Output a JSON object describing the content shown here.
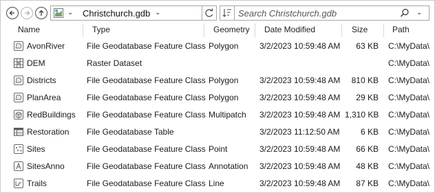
{
  "toolbar": {
    "back_icon": "arrow-left-icon",
    "forward_icon": "arrow-right-icon",
    "up_icon": "arrow-up-icon",
    "address_value": "Christchurch.gdb",
    "address_icon": "geodatabase-icon",
    "refresh_icon": "refresh-icon",
    "sort_icon": "sort-icon",
    "search_placeholder": "Search Christchurch.gdb",
    "search_icon": "search-icon"
  },
  "columns": [
    "Name",
    "Type",
    "Geometry",
    "Date Modified",
    "Size",
    "Path"
  ],
  "rows": [
    {
      "icon": "polygon-feature-class-icon",
      "name": "AvonRiver",
      "type": "File Geodatabase Feature Class",
      "geometry": "Polygon",
      "date": "3/2/2023 10:59:48 AM",
      "size": "63 KB",
      "path": "C:\\MyData\\"
    },
    {
      "icon": "raster-dataset-icon",
      "name": "DEM",
      "type": "Raster Dataset",
      "geometry": "",
      "date": "",
      "size": "",
      "path": "C:\\MyData\\"
    },
    {
      "icon": "polygon-feature-class-icon",
      "name": "Districts",
      "type": "File Geodatabase Feature Class",
      "geometry": "Polygon",
      "date": "3/2/2023 10:59:48 AM",
      "size": "810 KB",
      "path": "C:\\MyData\\"
    },
    {
      "icon": "polygon-feature-class-icon",
      "name": "PlanArea",
      "type": "File Geodatabase Feature Class",
      "geometry": "Polygon",
      "date": "3/2/2023 10:59:48 AM",
      "size": "29 KB",
      "path": "C:\\MyData\\"
    },
    {
      "icon": "multipatch-feature-class-icon",
      "name": "RedBuildings",
      "type": "File Geodatabase Feature Class",
      "geometry": "Multipatch",
      "date": "3/2/2023 10:59:48 AM",
      "size": "1,310 KB",
      "path": "C:\\MyData\\"
    },
    {
      "icon": "table-icon",
      "name": "Restoration",
      "type": "File Geodatabase Table",
      "geometry": "",
      "date": "3/2/2023 11:12:50 AM",
      "size": "6 KB",
      "path": "C:\\MyData\\"
    },
    {
      "icon": "point-feature-class-icon",
      "name": "Sites",
      "type": "File Geodatabase Feature Class",
      "geometry": "Point",
      "date": "3/2/2023 10:59:48 AM",
      "size": "66 KB",
      "path": "C:\\MyData\\"
    },
    {
      "icon": "annotation-feature-class-icon",
      "name": "SitesAnno",
      "type": "File Geodatabase Feature Class",
      "geometry": "Annotation",
      "date": "3/2/2023 10:59:48 AM",
      "size": "48 KB",
      "path": "C:\\MyData\\"
    },
    {
      "icon": "line-feature-class-icon",
      "name": "Trails",
      "type": "File Geodatabase Feature Class",
      "geometry": "Line",
      "date": "3/2/2023 10:59:48 AM",
      "size": "87 KB",
      "path": "C:\\MyData\\"
    }
  ]
}
